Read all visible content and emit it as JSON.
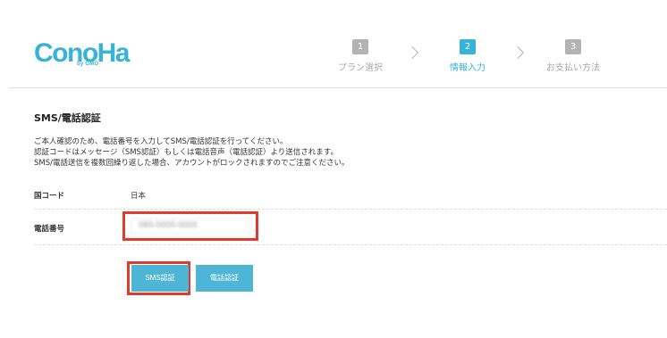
{
  "logo": {
    "text": "ConoHa",
    "sub": "by GMO"
  },
  "steps": [
    {
      "num": "1",
      "label": "プラン選択"
    },
    {
      "num": "2",
      "label": "情報入力"
    },
    {
      "num": "3",
      "label": "お支払い方法"
    }
  ],
  "colors": {
    "accent": "#36b3d6",
    "highlight": "#e23b2b",
    "button": "#4db6d6"
  },
  "section": {
    "title": "SMS/電話認証",
    "description": [
      "ご本人確認のため、電話番号を入力してSMS/電話認証を行ってください。",
      "認証コードはメッセージ（SMS認証）もしくは電話音声（電話認証）より送信されます。",
      "SMS/電話送信を複数回繰り返した場合、アカウントがロックされますのでご注意ください。"
    ]
  },
  "form": {
    "country": {
      "label": "国コード",
      "value": "日本"
    },
    "phone": {
      "label": "電話番号",
      "value": "080-0000-0000"
    }
  },
  "buttons": {
    "sms": "SMS認証",
    "tel": "電話認証"
  }
}
